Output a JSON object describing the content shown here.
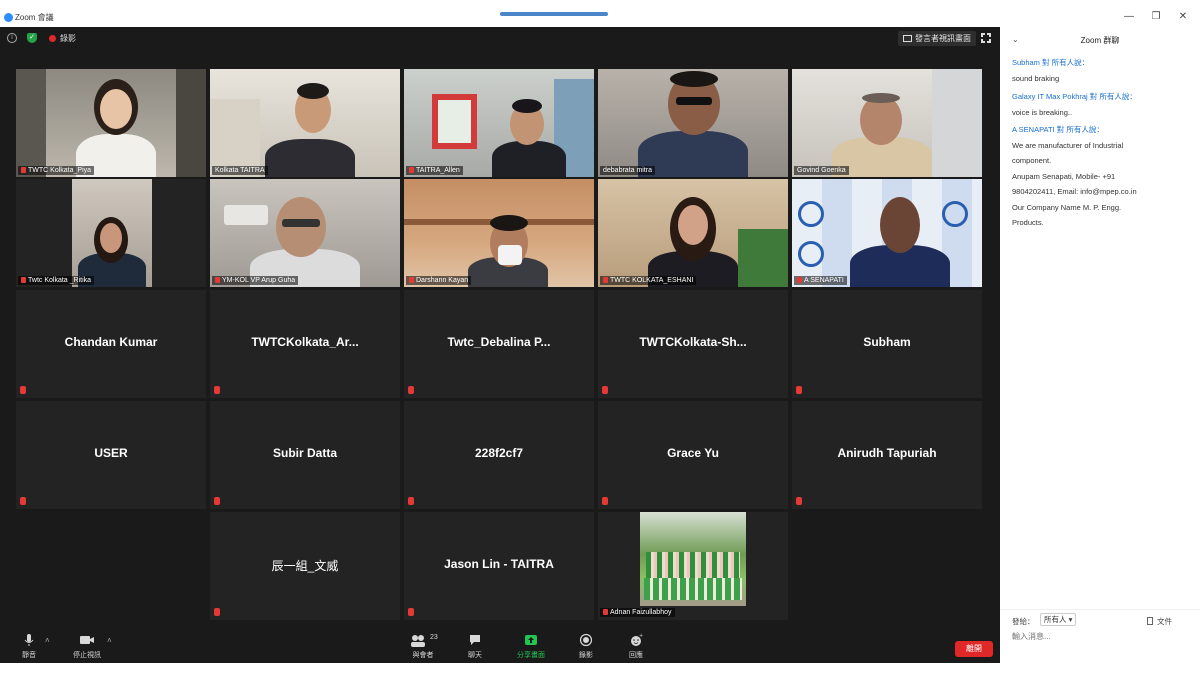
{
  "window": {
    "title": "Zoom 會議",
    "controls": [
      "—",
      "❐",
      "✕"
    ]
  },
  "topbar": {
    "recording_label": "錄影",
    "view_button_label": "發言者視訊畫面"
  },
  "tiles": [
    {
      "name": "TWTC Kolkata_Piya",
      "type": "video",
      "active": true,
      "muted": true
    },
    {
      "name": "Kolkata TAITRA",
      "type": "video",
      "muted": false
    },
    {
      "name": "TAITRA_Allen",
      "type": "video",
      "muted": true
    },
    {
      "name": "debabrata mitra",
      "type": "video",
      "muted": false
    },
    {
      "name": "Govind Goenka",
      "type": "video",
      "muted": false
    },
    {
      "name": "Twtc Kolkata _Ritika",
      "type": "video",
      "muted": true
    },
    {
      "name": "YM-KOL VP Arup Guha",
      "type": "video",
      "muted": true
    },
    {
      "name": "Darshann Kayan",
      "type": "video",
      "muted": true
    },
    {
      "name": "TWTC KOLKATA_ESHANI",
      "type": "video",
      "muted": true
    },
    {
      "name": "A SENAPATI",
      "type": "video",
      "muted": true
    },
    {
      "name": "Chandan Kumar",
      "type": "name",
      "muted": true
    },
    {
      "name": "TWTCKolkata_Ar...",
      "type": "name",
      "muted": true
    },
    {
      "name": "Twtc_Debalina P...",
      "type": "name",
      "muted": true
    },
    {
      "name": "TWTCKolkata-Sh...",
      "type": "name",
      "muted": true
    },
    {
      "name": "Subham",
      "type": "name",
      "muted": true
    },
    {
      "name": "USER",
      "type": "name",
      "muted": true
    },
    {
      "name": "Subir Datta",
      "type": "name",
      "muted": true
    },
    {
      "name": "228f2cf7",
      "type": "name",
      "muted": true
    },
    {
      "name": "Grace Yu",
      "type": "name",
      "muted": true
    },
    {
      "name": "Anirudh Tapuriah",
      "type": "name",
      "muted": true
    },
    {
      "name": "辰一組_文威",
      "type": "name",
      "muted": true
    },
    {
      "name": "Jason Lin - TAITRA",
      "type": "name",
      "muted": true
    },
    {
      "name": "Adnan Faizullabhoy",
      "type": "photo",
      "muted": true
    }
  ],
  "toolbar": {
    "mute_label": "靜音",
    "stop_video_label": "停止視訊",
    "participants_label": "與會者",
    "participants_count": "23",
    "chat_label": "聊天",
    "share_label": "分享畫面",
    "record_label": "錄影",
    "reactions_label": "回應",
    "end_label": "離開"
  },
  "chat": {
    "title": "Zoom 群聊",
    "messages": [
      {
        "sender": "Subham 對 所有人說：",
        "lines": [
          "sound braking"
        ]
      },
      {
        "sender": "Galaxy IT Max Pokhraj 對 所有人說：",
        "lines": [
          "voice is breaking.."
        ]
      },
      {
        "sender": "A SENAPATI 對 所有人說：",
        "lines": [
          "We are manufacturer of Industrial",
          "component.",
          "Anupam Senapati, Mobile- +91",
          "9804202411, Email: info@mpep.co.in",
          "Our Company Name M. P. Engg.",
          "Products."
        ]
      }
    ],
    "to_label": "發給：",
    "to_value": "所有人 ▾",
    "file_label": "文件",
    "input_placeholder": "輸入消息..."
  },
  "colors": {
    "meeting_bg": "#1a1a1a",
    "tile_bg": "#232323",
    "active_border": "#c7e85c",
    "share_green": "#23c552",
    "end_red": "#e02828",
    "chat_sender_blue": "#1a6fd0"
  }
}
